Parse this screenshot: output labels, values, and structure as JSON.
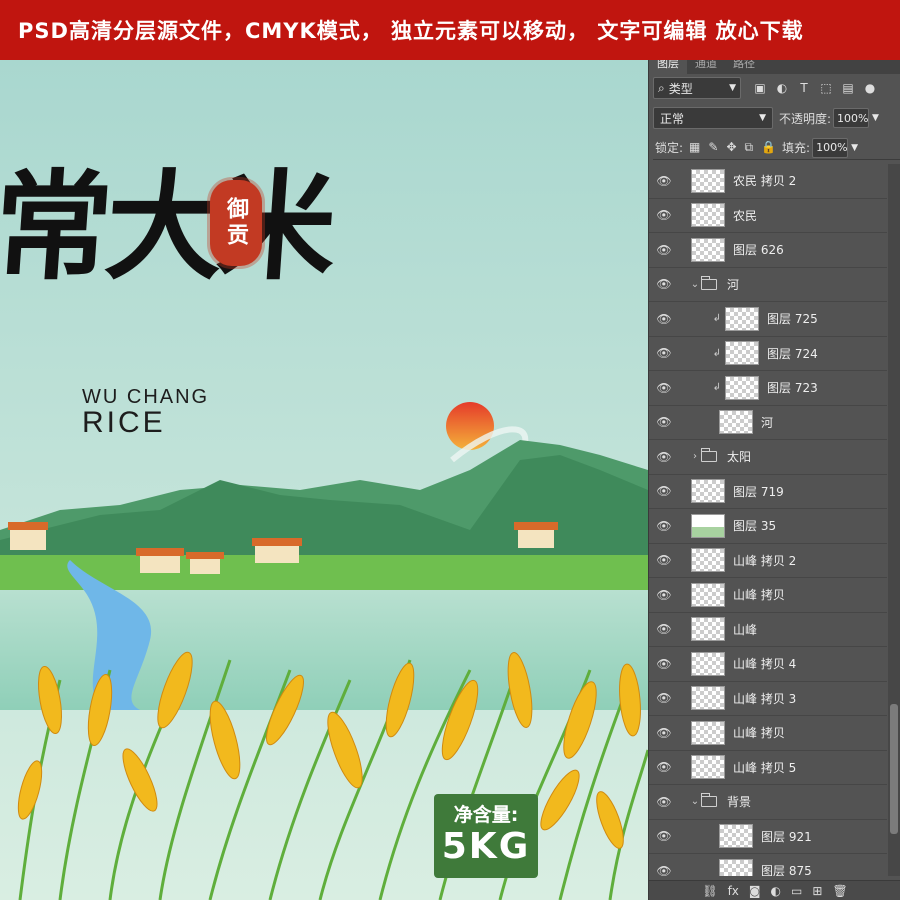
{
  "banner": {
    "text": "PSD高清分层源文件，CMYK模式， 独立元素可以移动， 文字可编辑 放心下载"
  },
  "artwork": {
    "title": "常大米",
    "seal": "御贡",
    "subtitle_en": "WU CHANG",
    "subtitle_rice": "RICE",
    "net_label": "净含量:",
    "net_value": "5KG"
  },
  "panel": {
    "tabs": [
      "图层",
      "通道",
      "路径"
    ],
    "filter": {
      "label": "类型"
    },
    "blend_mode": "正常",
    "opacity_label": "不透明度:",
    "opacity_value": "100%",
    "lock_label": "锁定:",
    "fill_label": "填充:",
    "fill_value": "100%",
    "layers": [
      {
        "name": "农民 拷贝 2"
      },
      {
        "name": "农民"
      },
      {
        "name": "图层 626"
      },
      {
        "name": "河"
      },
      {
        "name": "图层 725"
      },
      {
        "name": "图层 724"
      },
      {
        "name": "图层 723"
      },
      {
        "name": "河"
      },
      {
        "name": "太阳"
      },
      {
        "name": "图层 719"
      },
      {
        "name": "图层 35"
      },
      {
        "name": "山峰 拷贝 2"
      },
      {
        "name": "山峰 拷贝"
      },
      {
        "name": "山峰"
      },
      {
        "name": "山峰 拷贝 4"
      },
      {
        "name": "山峰 拷贝 3"
      },
      {
        "name": "山峰 拷贝"
      },
      {
        "name": "山峰 拷贝 5"
      },
      {
        "name": "背景"
      },
      {
        "name": "图层 921"
      },
      {
        "name": "图层 875"
      }
    ]
  },
  "colors": {
    "banner": "#c0150f",
    "panel": "#535353",
    "sky": "#bfe0d8",
    "badge": "#3f7a3a"
  }
}
